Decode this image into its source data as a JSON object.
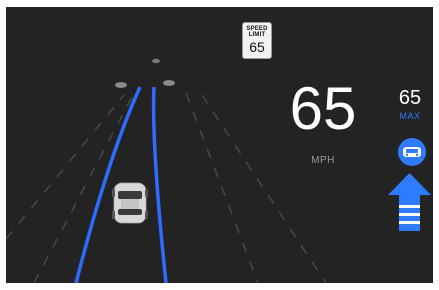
{
  "speed_limit_sign": {
    "header": "SPEED\nLIMIT",
    "value": "65"
  },
  "speed": {
    "value": "65",
    "unit": "MPH"
  },
  "cruise": {
    "max_value": "65",
    "max_label": "MAX"
  },
  "icons": {
    "autosteer": "steering-wheel-icon",
    "lane_change": "up-arrow-icon",
    "ego_vehicle": "car-icon",
    "vehicles_ahead": "car-icon"
  },
  "colors": {
    "background": "#232323",
    "lane_active": "#2f6bff",
    "lane_inactive": "#4a4a4a",
    "accent_blue": "#2f7bff",
    "text": "#ffffff",
    "unit_text": "#9b9b9b"
  }
}
